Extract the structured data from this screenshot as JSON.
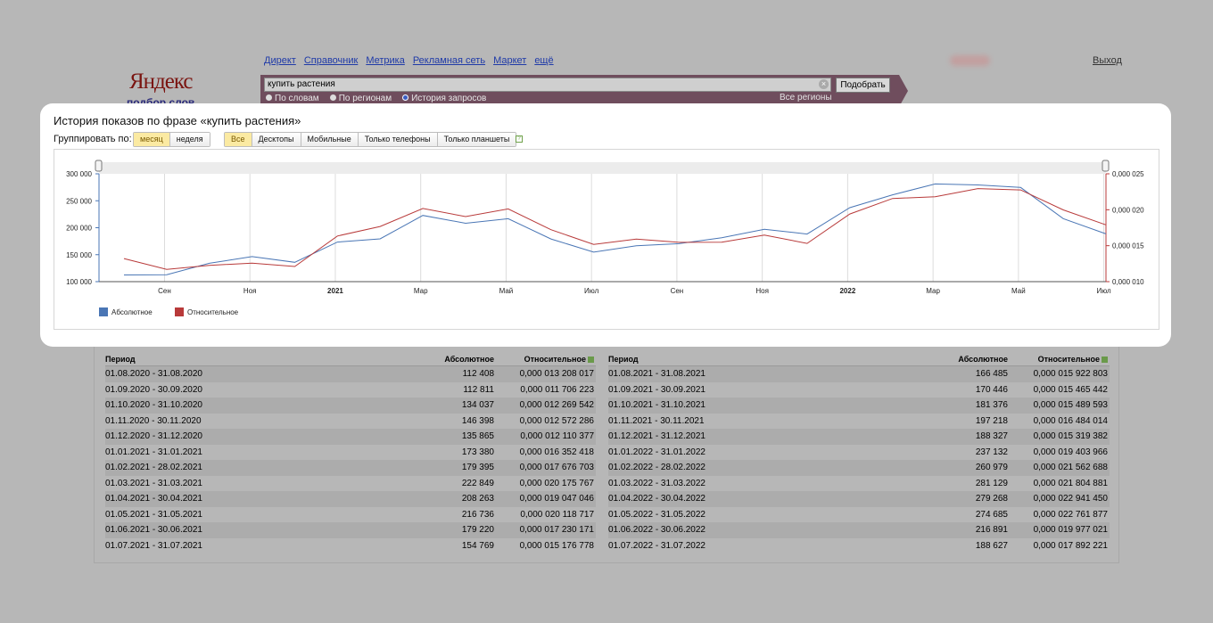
{
  "header": {
    "logo": "Яндекс",
    "logo_sub": "подбор слов",
    "nav": [
      "Директ",
      "Справочник",
      "Метрика",
      "Рекламная сеть",
      "Маркет",
      "ещё"
    ],
    "logout": "Выход"
  },
  "search": {
    "value": "купить растения",
    "button": "Подобрать",
    "modes": [
      "По словам",
      "По регионам",
      "История запросов"
    ],
    "selected_mode": "История запросов",
    "regions": "Все регионы"
  },
  "popup": {
    "title": "История показов по фразе «купить растения»",
    "group_label": "Группировать по:",
    "period_buttons": [
      "месяц",
      "неделя"
    ],
    "period_active": "месяц",
    "device_buttons": [
      "Все",
      "Десктопы",
      "Мобильные",
      "Только телефоны",
      "Только планшеты"
    ],
    "device_active": "Все",
    "help": "?"
  },
  "chart_data": {
    "type": "line",
    "x": [
      "08.2020",
      "09.2020",
      "10.2020",
      "11.2020",
      "12.2020",
      "01.2021",
      "02.2021",
      "03.2021",
      "04.2021",
      "05.2021",
      "06.2021",
      "07.2021",
      "08.2021",
      "09.2021",
      "10.2021",
      "11.2021",
      "12.2021",
      "01.2022",
      "02.2022",
      "03.2022",
      "04.2022",
      "05.2022",
      "06.2022",
      "07.2022"
    ],
    "x_tick_labels": [
      "Сен",
      "Ноя",
      "2021",
      "Мар",
      "Май",
      "Июл",
      "Сен",
      "Ноя",
      "2022",
      "Мар",
      "Май",
      "Июл"
    ],
    "y_left_ticks": [
      "300 000",
      "250 000",
      "200 000",
      "150 000",
      "100 000"
    ],
    "y_right_ticks": [
      "0,000 025",
      "0,000 020",
      "0,000 015",
      "0,000 010"
    ],
    "ylim_left": [
      100000,
      300000
    ],
    "ylim_right": [
      1e-05,
      2.5e-05
    ],
    "series": [
      {
        "name": "Абсолютное",
        "color": "#4a76b5",
        "axis": "left",
        "values": [
          112408,
          112811,
          134037,
          146398,
          135865,
          173380,
          179395,
          222849,
          208263,
          216736,
          179220,
          154769,
          166485,
          170446,
          181376,
          197218,
          188327,
          237132,
          260979,
          281129,
          279268,
          274685,
          216891,
          188627
        ]
      },
      {
        "name": "Относительное",
        "color": "#b83a3a",
        "axis": "right",
        "values": [
          1.3208017e-05,
          1.1706223e-05,
          1.2269542e-05,
          1.2572286e-05,
          1.2110377e-05,
          1.6352418e-05,
          1.7676703e-05,
          2.0175767e-05,
          1.9047046e-05,
          2.0118717e-05,
          1.7230171e-05,
          1.5176778e-05,
          1.5922803e-05,
          1.5465442e-05,
          1.5489593e-05,
          1.6484014e-05,
          1.5319382e-05,
          1.9403966e-05,
          2.1562688e-05,
          2.1804881e-05,
          2.294145e-05,
          2.2761877e-05,
          1.9977021e-05,
          1.7892221e-05
        ]
      }
    ],
    "legend": "bottom-left",
    "grid": true
  },
  "table": {
    "headers": {
      "period": "Период",
      "absolute": "Абсолютное",
      "relative": "Относительное"
    },
    "left": [
      [
        "01.08.2020 - 31.08.2020",
        "112 408",
        "0,000 013 208 017"
      ],
      [
        "01.09.2020 - 30.09.2020",
        "112 811",
        "0,000 011 706 223"
      ],
      [
        "01.10.2020 - 31.10.2020",
        "134 037",
        "0,000 012 269 542"
      ],
      [
        "01.11.2020 - 30.11.2020",
        "146 398",
        "0,000 012 572 286"
      ],
      [
        "01.12.2020 - 31.12.2020",
        "135 865",
        "0,000 012 110 377"
      ],
      [
        "01.01.2021 - 31.01.2021",
        "173 380",
        "0,000 016 352 418"
      ],
      [
        "01.02.2021 - 28.02.2021",
        "179 395",
        "0,000 017 676 703"
      ],
      [
        "01.03.2021 - 31.03.2021",
        "222 849",
        "0,000 020 175 767"
      ],
      [
        "01.04.2021 - 30.04.2021",
        "208 263",
        "0,000 019 047 046"
      ],
      [
        "01.05.2021 - 31.05.2021",
        "216 736",
        "0,000 020 118 717"
      ],
      [
        "01.06.2021 - 30.06.2021",
        "179 220",
        "0,000 017 230 171"
      ],
      [
        "01.07.2021 - 31.07.2021",
        "154 769",
        "0,000 015 176 778"
      ]
    ],
    "right": [
      [
        "01.08.2021 - 31.08.2021",
        "166 485",
        "0,000 015 922 803"
      ],
      [
        "01.09.2021 - 30.09.2021",
        "170 446",
        "0,000 015 465 442"
      ],
      [
        "01.10.2021 - 31.10.2021",
        "181 376",
        "0,000 015 489 593"
      ],
      [
        "01.11.2021 - 30.11.2021",
        "197 218",
        "0,000 016 484 014"
      ],
      [
        "01.12.2021 - 31.12.2021",
        "188 327",
        "0,000 015 319 382"
      ],
      [
        "01.01.2022 - 31.01.2022",
        "237 132",
        "0,000 019 403 966"
      ],
      [
        "01.02.2022 - 28.02.2022",
        "260 979",
        "0,000 021 562 688"
      ],
      [
        "01.03.2022 - 31.03.2022",
        "281 129",
        "0,000 021 804 881"
      ],
      [
        "01.04.2022 - 30.04.2022",
        "279 268",
        "0,000 022 941 450"
      ],
      [
        "01.05.2022 - 31.05.2022",
        "274 685",
        "0,000 022 761 877"
      ],
      [
        "01.06.2022 - 30.06.2022",
        "216 891",
        "0,000 019 977 021"
      ],
      [
        "01.07.2022 - 31.07.2022",
        "188 627",
        "0,000 017 892 221"
      ]
    ]
  }
}
